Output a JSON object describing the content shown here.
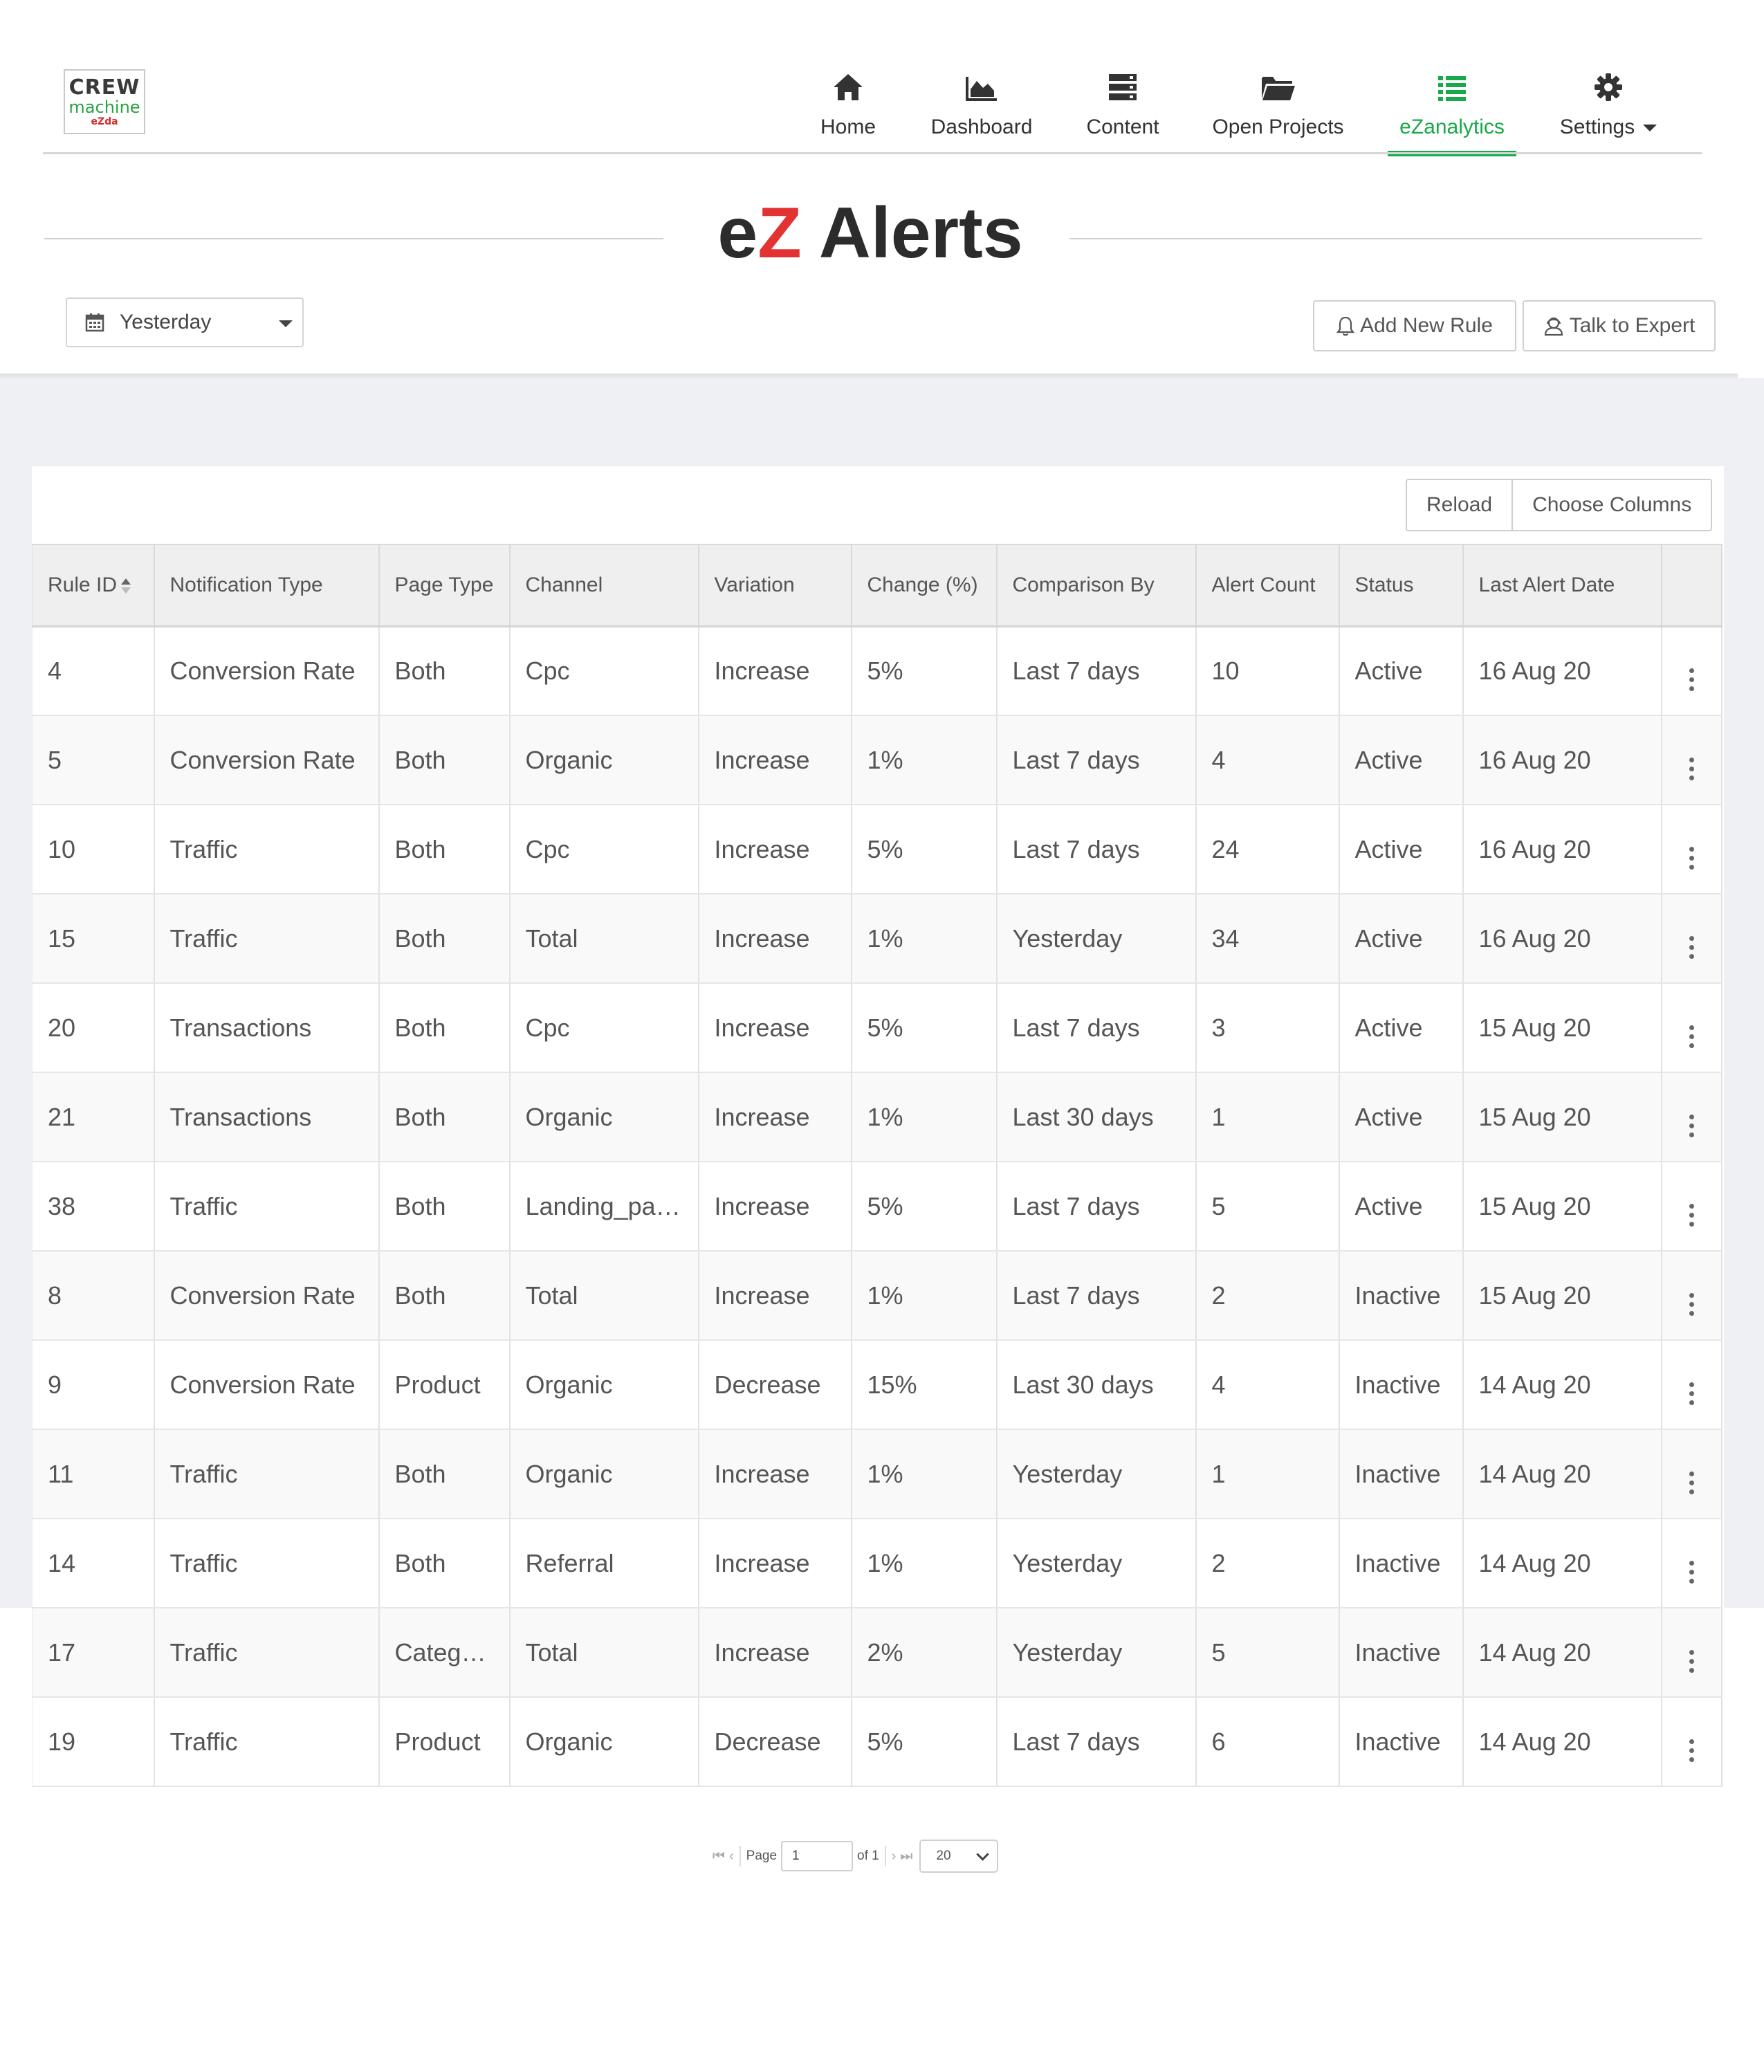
{
  "logo": {
    "line1": "CREW",
    "line2": "machine",
    "line3": "eZda"
  },
  "nav": {
    "items": [
      {
        "label": "Home",
        "icon": "home-icon"
      },
      {
        "label": "Dashboard",
        "icon": "area-chart-icon"
      },
      {
        "label": "Content",
        "icon": "server-icon"
      },
      {
        "label": "Open Projects",
        "icon": "folder-open-icon"
      },
      {
        "label": "eZanalytics",
        "icon": "list-icon",
        "active": true
      },
      {
        "label": "Settings",
        "icon": "gear-icon"
      }
    ]
  },
  "page": {
    "title_prefix_e": "e",
    "title_prefix_z": "Z",
    "title_rest": " Alerts"
  },
  "filter": {
    "date_range": "Yesterday"
  },
  "actions": {
    "add_rule": "Add New Rule",
    "talk_expert": "Talk to Expert"
  },
  "table_toolbar": {
    "reload": "Reload",
    "choose_columns": "Choose Columns"
  },
  "table": {
    "columns": [
      "Rule ID",
      "Notification Type",
      "Page Type",
      "Channel",
      "Variation",
      "Change (%)",
      "Comparison By",
      "Alert Count",
      "Status",
      "Last Alert Date"
    ],
    "rows": [
      [
        "4",
        "Conversion Rate",
        "Both",
        "Cpc",
        "Increase",
        "5%",
        "Last 7 days",
        "10",
        "Active",
        "16 Aug 20"
      ],
      [
        "5",
        "Conversion Rate",
        "Both",
        "Organic",
        "Increase",
        "1%",
        "Last 7 days",
        "4",
        "Active",
        "16 Aug 20"
      ],
      [
        "10",
        "Traffic",
        "Both",
        "Cpc",
        "Increase",
        "5%",
        "Last 7 days",
        "24",
        "Active",
        "16 Aug 20"
      ],
      [
        "15",
        "Traffic",
        "Both",
        "Total",
        "Increase",
        "1%",
        "Yesterday",
        "34",
        "Active",
        "16 Aug 20"
      ],
      [
        "20",
        "Transactions",
        "Both",
        "Cpc",
        "Increase",
        "5%",
        "Last 7 days",
        "3",
        "Active",
        "15 Aug 20"
      ],
      [
        "21",
        "Transactions",
        "Both",
        "Organic",
        "Increase",
        "1%",
        "Last 30 days",
        "1",
        "Active",
        "15 Aug 20"
      ],
      [
        "38",
        "Traffic",
        "Both",
        "Landing_page",
        "Increase",
        "5%",
        "Last 7 days",
        "5",
        "Active",
        "15 Aug 20"
      ],
      [
        "8",
        "Conversion Rate",
        "Both",
        "Total",
        "Increase",
        "1%",
        "Last 7 days",
        "2",
        "Inactive",
        "15 Aug 20"
      ],
      [
        "9",
        "Conversion Rate",
        "Product",
        "Organic",
        "Decrease",
        "15%",
        "Last 30 days",
        "4",
        "Inactive",
        "14 Aug 20"
      ],
      [
        "11",
        "Traffic",
        "Both",
        "Organic",
        "Increase",
        "1%",
        "Yesterday",
        "1",
        "Inactive",
        "14 Aug 20"
      ],
      [
        "14",
        "Traffic",
        "Both",
        "Referral",
        "Increase",
        "1%",
        "Yesterday",
        "2",
        "Inactive",
        "14 Aug 20"
      ],
      [
        "17",
        "Traffic",
        "Category",
        "Total",
        "Increase",
        "2%",
        "Yesterday",
        "5",
        "Inactive",
        "14 Aug 20"
      ],
      [
        "19",
        "Traffic",
        "Product",
        "Organic",
        "Decrease",
        "5%",
        "Last 7 days",
        "6",
        "Inactive",
        "14 Aug 20"
      ]
    ]
  },
  "pager": {
    "page_label": "Page",
    "page_value": "1",
    "of_label": "of 1",
    "page_size": "20"
  },
  "colors": {
    "accent": "#17a94a",
    "brand_red": "#e23232",
    "band": "#eff0f3"
  }
}
